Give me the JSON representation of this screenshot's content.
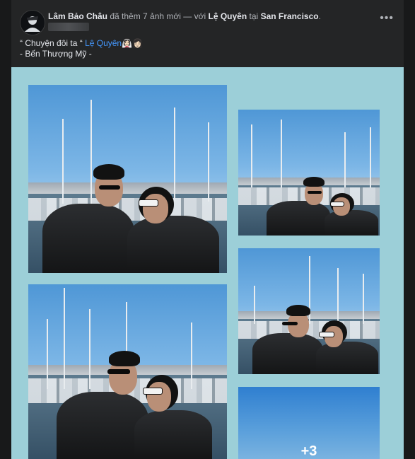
{
  "post": {
    "author": "Lâm Bảo Châu",
    "action_text": "đã thêm 7 ảnh mới — với",
    "tagged_user": "Lệ Quyên",
    "location_prefix": "tại",
    "location": "San Francisco",
    "location_suffix": ".",
    "more_options": "•••"
  },
  "caption": {
    "quote_open": "“ Chuyện đôi ta “",
    "tag": "Lệ Quyên",
    "emojis": "👰🏻‍♀️👩🏻",
    "line2": "- Bến Thượng Mỹ -"
  },
  "gallery": {
    "photo_count": 7,
    "visible_tiles": 5,
    "more_label": "+3"
  },
  "colors": {
    "page_bg": "#18191a",
    "card_bg": "#242526",
    "gallery_bg": "#9ccfd8",
    "link_blue": "#4599ff",
    "text_primary": "#e4e6eb"
  }
}
